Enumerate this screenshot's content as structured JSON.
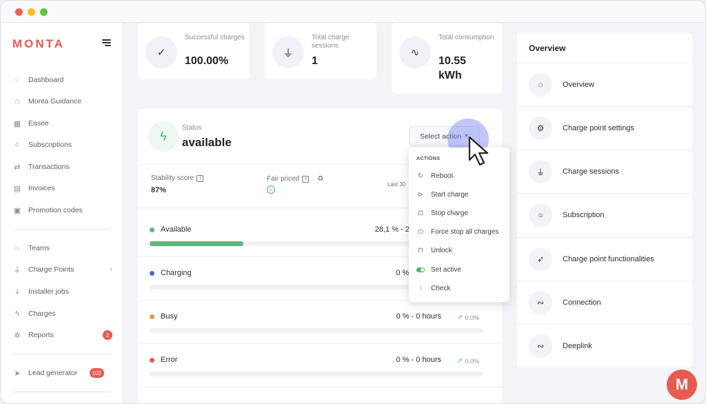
{
  "brand": {
    "logo": "MONTA",
    "fab_letter": "M",
    "accent": "#e85a4f"
  },
  "sidebar": {
    "items": [
      {
        "label": "Dashboard",
        "icon": "dashboard-icon"
      },
      {
        "label": "Monta Guidance",
        "icon": "home-icon"
      },
      {
        "label": "Easee",
        "icon": "building-icon"
      },
      {
        "label": "Subscriptions",
        "icon": "lightbulb-icon"
      },
      {
        "label": "Transactions",
        "icon": "arrows-icon"
      },
      {
        "label": "Invoices",
        "icon": "invoice-icon"
      },
      {
        "label": "Promotion codes",
        "icon": "gift-icon"
      },
      {
        "label": "Teams",
        "icon": "grid-icon"
      },
      {
        "label": "Charge Points",
        "icon": "plug-icon"
      },
      {
        "label": "Installer jobs",
        "icon": "download-icon"
      },
      {
        "label": "Charges",
        "icon": "bolt-icon"
      },
      {
        "label": "Reports",
        "icon": "bug-icon",
        "badge": "2"
      },
      {
        "label": "Lead generator",
        "icon": "send-icon",
        "badge": "102"
      }
    ]
  },
  "stats": [
    {
      "label": "Successful charges",
      "value": "100.00%",
      "icon": "check-icon"
    },
    {
      "label": "Total charge sessions",
      "value": "1",
      "icon": "plug-icon"
    },
    {
      "label": "Total consumption",
      "value": "10.55 kWh",
      "icon": "pulse-icon"
    }
  ],
  "status": {
    "label": "Status",
    "value": "available",
    "stability_label": "Stability score",
    "stability_value": "87%",
    "fair_priced_label": "Fair priced",
    "last_label": "Last 30",
    "select_action": "Select action"
  },
  "rows": [
    {
      "name": "Available",
      "value": "28,1 % - 20",
      "trend": "",
      "color": "#5fb67b",
      "fill": 0.281
    },
    {
      "name": "Charging",
      "value": "0 % -",
      "trend": "",
      "color": "#5560d8",
      "fill": 0
    },
    {
      "name": "Busy",
      "value": "0 % - 0 hours",
      "trend": "0.0%",
      "color": "#e8964a",
      "fill": 0
    },
    {
      "name": "Error",
      "value": "0 % - 0 hours",
      "trend": "0.0%",
      "color": "#e05a55",
      "fill": 0
    }
  ],
  "dropdown": {
    "header": "ACTIONS",
    "items": [
      {
        "label": "Reboot",
        "icon": "reboot-icon"
      },
      {
        "label": "Start charge",
        "icon": "play-icon"
      },
      {
        "label": "Stop charge",
        "icon": "stop-icon"
      },
      {
        "label": "Force stop all charges",
        "icon": "power-icon"
      },
      {
        "label": "Unlock",
        "icon": "lock-icon"
      },
      {
        "label": "Set active",
        "icon": "toggle-icon"
      },
      {
        "label": "Check",
        "icon": "signal-icon"
      }
    ]
  },
  "overview": {
    "title": "Overview",
    "items": [
      {
        "label": "Overview",
        "icon": "dashboard-icon"
      },
      {
        "label": "Charge point settings",
        "icon": "gear-icon"
      },
      {
        "label": "Charge sessions",
        "icon": "plug-icon"
      },
      {
        "label": "Subscription",
        "icon": "lightbulb-icon"
      },
      {
        "label": "Charge point functionalities",
        "icon": "rocket-icon"
      },
      {
        "label": "Connection",
        "icon": "route-icon"
      },
      {
        "label": "Deeplink",
        "icon": "route-icon"
      }
    ]
  }
}
